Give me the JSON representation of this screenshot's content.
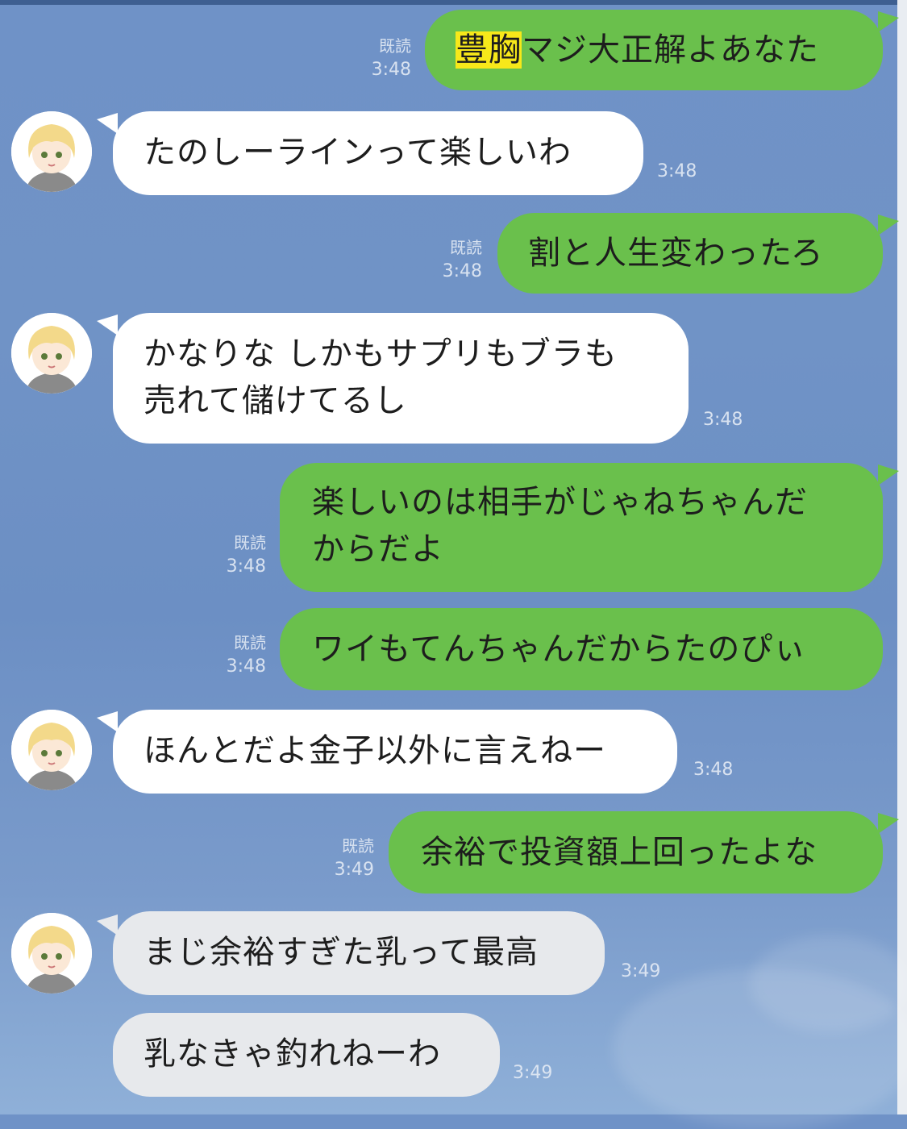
{
  "chat": {
    "messages": [
      {
        "side": "out",
        "parts": [
          "豊胸",
          "マジ大正解よあなた"
        ],
        "read": "既読",
        "time": "3:48"
      },
      {
        "side": "in",
        "lines": [
          "たのしーラインって楽しいわ"
        ],
        "time": "3:48"
      },
      {
        "side": "out",
        "text": "割と人生変わったろ",
        "read": "既読",
        "time": "3:48"
      },
      {
        "side": "in",
        "lines": [
          "かなりな しかもサプリもブラも",
          "売れて儲けてるし"
        ],
        "time": "3:48"
      },
      {
        "side": "out",
        "lines": [
          "楽しいのは相手がじゃねちゃんだ",
          "からだよ"
        ],
        "read": "既読",
        "time": "3:48"
      },
      {
        "side": "out",
        "text": "ワイもてんちゃんだからたのぴぃ",
        "read": "既読",
        "time": "3:48"
      },
      {
        "side": "in",
        "lines": [
          "ほんとだよ金子以外に言えねー"
        ],
        "time": "3:48"
      },
      {
        "side": "out",
        "text": "余裕で投資額上回ったよな",
        "read": "既読",
        "time": "3:49"
      },
      {
        "side": "in",
        "lines": [
          "まじ余裕すぎた乳って最高"
        ],
        "time": "3:49"
      },
      {
        "side": "in",
        "lines": [
          "乳なきゃ釣れねーわ"
        ],
        "time": "3:49"
      }
    ]
  },
  "colors": {
    "background": "#7093c6",
    "outgoing_bubble": "#6ac04c",
    "incoming_bubble": "#ffffff",
    "highlight": "#f7e81a"
  }
}
